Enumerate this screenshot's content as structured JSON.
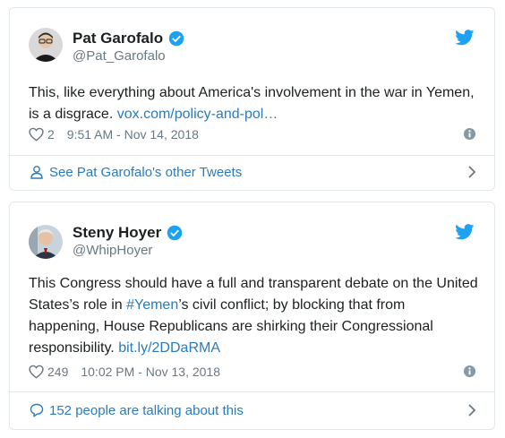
{
  "tweets": [
    {
      "author": {
        "name": "Pat Garofalo",
        "handle": "@Pat_Garofalo"
      },
      "text_before": "This, like everything about America's involvement in the war in Yemen, is a disgrace. ",
      "link_text": "vox.com/policy-and-pol…",
      "likes": "2",
      "timestamp": "9:51 AM - Nov 14, 2018",
      "footer": "See Pat Garofalo's other Tweets"
    },
    {
      "author": {
        "name": "Steny Hoyer",
        "handle": "@WhipHoyer"
      },
      "text_before": "This Congress should have a full and transparent debate on the United States’s role in ",
      "hashtag": "#Yemen",
      "text_after": "’s civil conflict; by blocking that from happening, House Republicans are shirking their Congressional responsibility.  ",
      "link_text": "bit.ly/2DDaRMA",
      "likes": "249",
      "timestamp": "10:02 PM - Nov 13, 2018",
      "footer": "152 people are talking about this"
    }
  ],
  "colors": {
    "link": "#2b7bb9",
    "twitter_blue": "#1da1f2",
    "meta_gray": "#697882",
    "border": "#e1e8ed"
  },
  "icons": [
    "avatar",
    "verified-badge-icon",
    "twitter-bird-icon",
    "heart-icon",
    "info-icon",
    "person-icon",
    "speech-bubble-icon",
    "chevron-right-icon"
  ]
}
